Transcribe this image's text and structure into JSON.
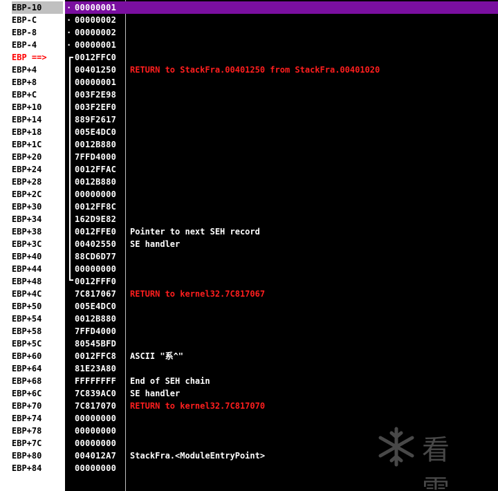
{
  "rows": [
    {
      "offset": "EBP-10",
      "value": "00000001",
      "comment": "",
      "dot": true,
      "selected": true
    },
    {
      "offset": "EBP-C",
      "value": "00000002",
      "comment": "",
      "dot": true
    },
    {
      "offset": "EBP-8",
      "value": "00000002",
      "comment": "",
      "dot": true
    },
    {
      "offset": "EBP-4",
      "value": "00000001",
      "comment": "",
      "dot": true
    },
    {
      "offset": "EBP ==>",
      "value": "0012FFC0",
      "comment": "",
      "current": true
    },
    {
      "offset": "EBP+4",
      "value": "00401250",
      "comment": "RETURN to StackFra.00401250 from StackFra.00401020",
      "red": true
    },
    {
      "offset": "EBP+8",
      "value": "00000001",
      "comment": ""
    },
    {
      "offset": "EBP+C",
      "value": "003F2E98",
      "comment": ""
    },
    {
      "offset": "EBP+10",
      "value": "003F2EF0",
      "comment": ""
    },
    {
      "offset": "EBP+14",
      "value": "889F2617",
      "comment": ""
    },
    {
      "offset": "EBP+18",
      "value": "005E4DC0",
      "comment": ""
    },
    {
      "offset": "EBP+1C",
      "value": "0012B880",
      "comment": ""
    },
    {
      "offset": "EBP+20",
      "value": "7FFD4000",
      "comment": ""
    },
    {
      "offset": "EBP+24",
      "value": "0012FFAC",
      "comment": ""
    },
    {
      "offset": "EBP+28",
      "value": "0012B880",
      "comment": ""
    },
    {
      "offset": "EBP+2C",
      "value": "00000000",
      "comment": ""
    },
    {
      "offset": "EBP+30",
      "value": "0012FF8C",
      "comment": ""
    },
    {
      "offset": "EBP+34",
      "value": "162D9E82",
      "comment": ""
    },
    {
      "offset": "EBP+38",
      "value": "0012FFE0",
      "comment": "Pointer to next SEH record"
    },
    {
      "offset": "EBP+3C",
      "value": "00402550",
      "comment": "SE handler"
    },
    {
      "offset": "EBP+40",
      "value": "88CD6D77",
      "comment": ""
    },
    {
      "offset": "EBP+44",
      "value": "00000000",
      "comment": ""
    },
    {
      "offset": "EBP+48",
      "value": "0012FFF0",
      "comment": ""
    },
    {
      "offset": "EBP+4C",
      "value": "7C817067",
      "comment": "RETURN to kernel32.7C817067",
      "red": true
    },
    {
      "offset": "EBP+50",
      "value": "005E4DC0",
      "comment": ""
    },
    {
      "offset": "EBP+54",
      "value": "0012B880",
      "comment": ""
    },
    {
      "offset": "EBP+58",
      "value": "7FFD4000",
      "comment": ""
    },
    {
      "offset": "EBP+5C",
      "value": "80545BFD",
      "comment": ""
    },
    {
      "offset": "EBP+60",
      "value": "0012FFC8",
      "comment": "ASCII \"系^\""
    },
    {
      "offset": "EBP+64",
      "value": "81E23A80",
      "comment": ""
    },
    {
      "offset": "EBP+68",
      "value": "FFFFFFFF",
      "comment": "End of SEH chain"
    },
    {
      "offset": "EBP+6C",
      "value": "7C839AC0",
      "comment": "SE handler"
    },
    {
      "offset": "EBP+70",
      "value": "7C817070",
      "comment": "RETURN to kernel32.7C817070",
      "red": true
    },
    {
      "offset": "EBP+74",
      "value": "00000000",
      "comment": ""
    },
    {
      "offset": "EBP+78",
      "value": "00000000",
      "comment": ""
    },
    {
      "offset": "EBP+7C",
      "value": "00000000",
      "comment": ""
    },
    {
      "offset": "EBP+80",
      "value": "004012A7",
      "comment": "StackFra.<ModuleEntryPoint>"
    },
    {
      "offset": "EBP+84",
      "value": "00000000",
      "comment": ""
    }
  ],
  "watermark": {
    "text": "看雪",
    "icon": "snowflake-icon"
  },
  "colors": {
    "background": "#000000",
    "selection": "#7a0fa0",
    "return_comment": "#ff1e1e",
    "current_offset": "#ff0000"
  }
}
